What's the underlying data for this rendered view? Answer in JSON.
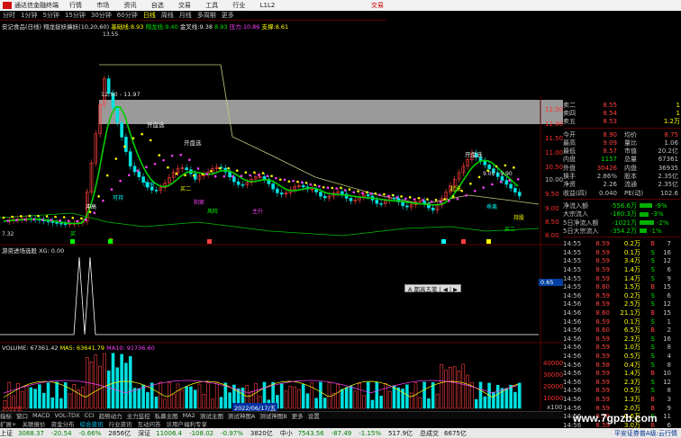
{
  "titlebar": {
    "app_title": "通达信金融终端",
    "menu": [
      "行情",
      "市场",
      "资讯",
      "自选",
      "交易",
      "工具",
      "行业",
      "L1L2"
    ],
    "right_label": "交易"
  },
  "periods": [
    "分时",
    "1分钟",
    "5分钟",
    "15分钟",
    "30分钟",
    "60分钟",
    "日线",
    "周线",
    "月线",
    "多周期",
    "更多"
  ],
  "active_period": "日线",
  "main_caption": {
    "stock": "安记食品(日线)",
    "indicator": "翔龙捉妖擒妖(10,20,60)",
    "base_label": "基础线:",
    "base_value": "8.93",
    "dragon_label": "翔龙线:",
    "dragon_value": "9.40",
    "gold_label": "金叉线:",
    "gold_value": "9.38",
    "extra": "8.93",
    "pressure_label": "压力:",
    "pressure_value": "10.86",
    "support_label": "支撑:",
    "support_value": "8.61"
  },
  "chart_annotations": {
    "peak": "13.55",
    "range": "12.90 - 11.97",
    "range2": "9.00 - 9.90",
    "low_left": "7.32",
    "open_left": "开盘选",
    "open_mid": "开盘选",
    "open_right": "开盘选",
    "buy_labels": [
      "买",
      "卖",
      "加仓",
      "买二",
      "风险",
      "主升",
      "起涨",
      "乖离",
      "持股",
      "冲高",
      "可持",
      "和家",
      "买二"
    ]
  },
  "y_axis_main": [
    "12.50",
    "12.00",
    "11.50",
    "11.00",
    "10.50",
    "10.00",
    "9.50",
    "9.00",
    "8.50",
    "8.00"
  ],
  "y_axis_mid": [
    "0.65"
  ],
  "y_axis_vol": [
    "40000",
    "30000",
    "20000",
    "10000",
    "x100"
  ],
  "sub_indicator": {
    "caption": "游资进场选股 XG: 0.00"
  },
  "volume_caption": {
    "vol": "VOLUME: 67361.42",
    "ma5": "MA5: 63641.79",
    "ma10": "MA10: 91736.60"
  },
  "date_label": "2022/06/17/五",
  "left_date": "2022年",
  "mini_toolbar": "A 都高五笔 | ◀ | ▶",
  "quote": {
    "ask": [
      {
        "k": "卖二",
        "v": "8.55",
        "n": "1"
      },
      {
        "k": "卖四",
        "v": "8.54",
        "n": "1"
      },
      {
        "k": "卖五",
        "v": "8.53",
        "n": "1.2万"
      }
    ],
    "stats": [
      {
        "k": "今开",
        "v": "8.90",
        "k2": "均价",
        "v2": "8.75"
      },
      {
        "k": "最高",
        "v": "9.09",
        "k2": "量比",
        "v2": "1.06"
      },
      {
        "k": "最低",
        "v": "8.57",
        "k2": "市值",
        "v2": "20.2亿"
      },
      {
        "k": "内盘",
        "v": "1157",
        "k2": "总量",
        "v2": "67361"
      },
      {
        "k": "外盘",
        "v": "30426",
        "k2": "内盘",
        "v2": "36935"
      },
      {
        "k": "换手",
        "v": "2.86%",
        "k2": "股本",
        "v2": "2.35亿"
      },
      {
        "k": "净资",
        "v": "2.26",
        "k2": "流通",
        "v2": "2.35亿"
      },
      {
        "k": "收益(四)",
        "v": "0.040",
        "k2": "PE(动)",
        "v2": "102.6"
      }
    ],
    "flows": [
      {
        "k": "净流入额",
        "v": "-556.6万",
        "pct": "-9%"
      },
      {
        "k": "大宗流入",
        "v": "-180.3万",
        "pct": "-3%"
      },
      {
        "k": "5日净流入额",
        "v": "-1021万",
        "pct": "-2%"
      },
      {
        "k": "5日大宗流入",
        "v": "-354.2万",
        "pct": "-1%"
      }
    ],
    "ticks": [
      {
        "t": "14:55",
        "p": "8.59",
        "vol": "0.2万",
        "bs": "B",
        "n": "7"
      },
      {
        "t": "14:55",
        "p": "8.59",
        "vol": "0.1万",
        "bs": "S",
        "n": "16"
      },
      {
        "t": "14:55",
        "p": "8.59",
        "vol": "3.4万",
        "bs": "S",
        "n": "12"
      },
      {
        "t": "14:55",
        "p": "8.59",
        "vol": "1.4万",
        "bs": "S",
        "n": "6"
      },
      {
        "t": "14:55",
        "p": "8.59",
        "vol": "1.4万",
        "bs": "S",
        "n": "9"
      },
      {
        "t": "14:55",
        "p": "8.60",
        "vol": "1.5万",
        "bs": "B",
        "n": "15"
      },
      {
        "t": "14:56",
        "p": "8.59",
        "vol": "0.2万",
        "bs": "S",
        "n": "6"
      },
      {
        "t": "14:56",
        "p": "8.59",
        "vol": "2.5万",
        "bs": "S",
        "n": "12"
      },
      {
        "t": "14:56",
        "p": "8.60",
        "vol": "21.1万",
        "bs": "B",
        "n": "15"
      },
      {
        "t": "14:56",
        "p": "8.59",
        "vol": "0.1万",
        "bs": "S",
        "n": "1"
      },
      {
        "t": "14:56",
        "p": "8.60",
        "vol": "6.5万",
        "bs": "B",
        "n": "2"
      },
      {
        "t": "14:56",
        "p": "8.59",
        "vol": "2.3万",
        "bs": "S",
        "n": "16"
      },
      {
        "t": "14:56",
        "p": "8.59",
        "vol": "1.0万",
        "bs": "S",
        "n": "8"
      },
      {
        "t": "14:56",
        "p": "8.59",
        "vol": "0.5万",
        "bs": "S",
        "n": "4"
      },
      {
        "t": "14:56",
        "p": "8.58",
        "vol": "0.4万",
        "bs": "S",
        "n": "8"
      },
      {
        "t": "14:56",
        "p": "8.59",
        "vol": "1.4万",
        "bs": "B",
        "n": "10"
      },
      {
        "t": "14:56",
        "p": "8.59",
        "vol": "2.3万",
        "bs": "S",
        "n": "12"
      },
      {
        "t": "14:56",
        "p": "8.59",
        "vol": "0.5万",
        "bs": "S",
        "n": "8"
      },
      {
        "t": "14:56",
        "p": "8.59",
        "vol": "1.3万",
        "bs": "B",
        "n": "3"
      },
      {
        "t": "14:56",
        "p": "8.59",
        "vol": "2.0万",
        "bs": "B",
        "n": "9"
      },
      {
        "t": "14:56",
        "p": "8.58",
        "vol": "0.6万",
        "bs": "S",
        "n": "11"
      },
      {
        "t": "14:56",
        "p": "8.59",
        "vol": "3.0万",
        "bs": "B",
        "n": "6"
      },
      {
        "t": "14:57",
        "p": "8.59",
        "vol": "2.0万",
        "bs": "B",
        "n": "3"
      },
      {
        "t": "14:57",
        "p": "8.59",
        "vol": "1.6万",
        "bs": "S",
        "n": "6"
      }
    ],
    "bottom_tabs": [
      "笔",
      "价",
      "细",
      "盘",
      "模板",
      "F"
    ]
  },
  "indicator_tabs": [
    "指标",
    "窗口",
    "MACD",
    "VOL-TDX",
    "CCI",
    "趋势动力",
    "主力监控",
    "私募主图",
    "MA2",
    "测试主图",
    "测试神图A",
    "测试神图B",
    "更多",
    "设置"
  ],
  "sub_tabs": [
    "扩展+",
    "关联报价",
    "资金分布",
    "综合资讯",
    "行业资讯",
    "互动问答",
    "诊用户福利专享"
  ],
  "active_sub_tab": "综合资讯",
  "status": [
    {
      "label": "上证",
      "v": "3088.37",
      "c": "-20.54",
      "p": "-0.66%",
      "amt": "2856亿"
    },
    {
      "label": "深证",
      "v": "11006.4",
      "c": "-108.02",
      "p": "-0.97%",
      "amt": "3820亿"
    },
    {
      "label": "中小",
      "v": "7543.56",
      "c": "-87.49",
      "p": "-1.15%",
      "amt": "517.9亿"
    },
    {
      "label": "总成交",
      "v": "6675亿",
      "c": "",
      "p": "",
      "amt": ""
    }
  ],
  "status_right": "平安证券普A级:云行情",
  "watermark": "www.7gpzb.com",
  "colors": {
    "up": "#ff4040",
    "down": "#00e0e0",
    "accent": "#ffff00",
    "bg": "#000000"
  }
}
